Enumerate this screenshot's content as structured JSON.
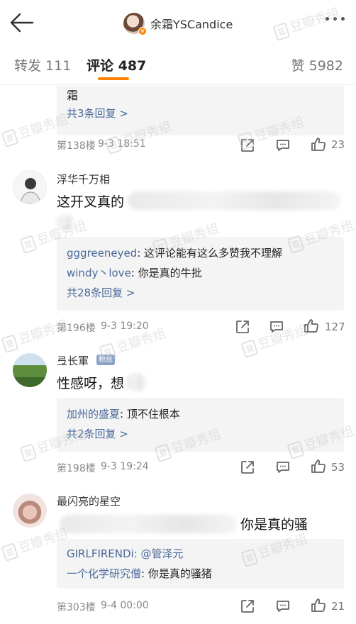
{
  "header": {
    "author_name": "余霜YSCandice"
  },
  "tabs": [
    {
      "label": "转发 111"
    },
    {
      "label": "评论 487"
    },
    {
      "label": "赞 5982"
    }
  ],
  "comments": [
    {
      "text": "霜",
      "more_replies": "共3条回复 >",
      "floor": "第138楼",
      "time": "9-3 18:51",
      "likes": "23"
    },
    {
      "username": "浮华千万相",
      "text": "这开叉真的",
      "replies": [
        {
          "name": "gggreeneyed",
          "text": ": 这评论能有这么多赞我不理解"
        },
        {
          "name": "windy丶love",
          "text": ": 你是真的牛批"
        }
      ],
      "more_replies": "共28条回复 >",
      "floor": "第196楼",
      "time": "9-3 19:20",
      "likes": "127"
    },
    {
      "username": "弖长軍",
      "badge": "粉丝",
      "text": "性感呀，想",
      "replies": [
        {
          "name": "加州的盛夏",
          "text": ": 顶不住根本"
        }
      ],
      "more_replies": "共2条回复 >",
      "floor": "第198楼",
      "time": "9-3 19:24",
      "likes": "53"
    },
    {
      "username": "最闪亮的星空",
      "text": "你是真的骚",
      "replies": [
        {
          "name": "GIRLFIRENDi",
          "text": ": @管泽元"
        },
        {
          "name": "一个化学研究僧",
          "text": ": 你是真的骚猪"
        }
      ],
      "floor": "第303楼",
      "time": "9-4 00:00",
      "likes": "21"
    }
  ],
  "watermark": {
    "badge": "豆",
    "text": "豆瓣秀组"
  },
  "colors": {
    "accent": "#ff8200",
    "link": "#4a6a9a",
    "reply_bg": "#f4f4f4"
  },
  "icons": [
    "back-arrow-icon",
    "more-dots-icon",
    "share-icon",
    "comment-icon",
    "like-icon",
    "verified-icon"
  ]
}
